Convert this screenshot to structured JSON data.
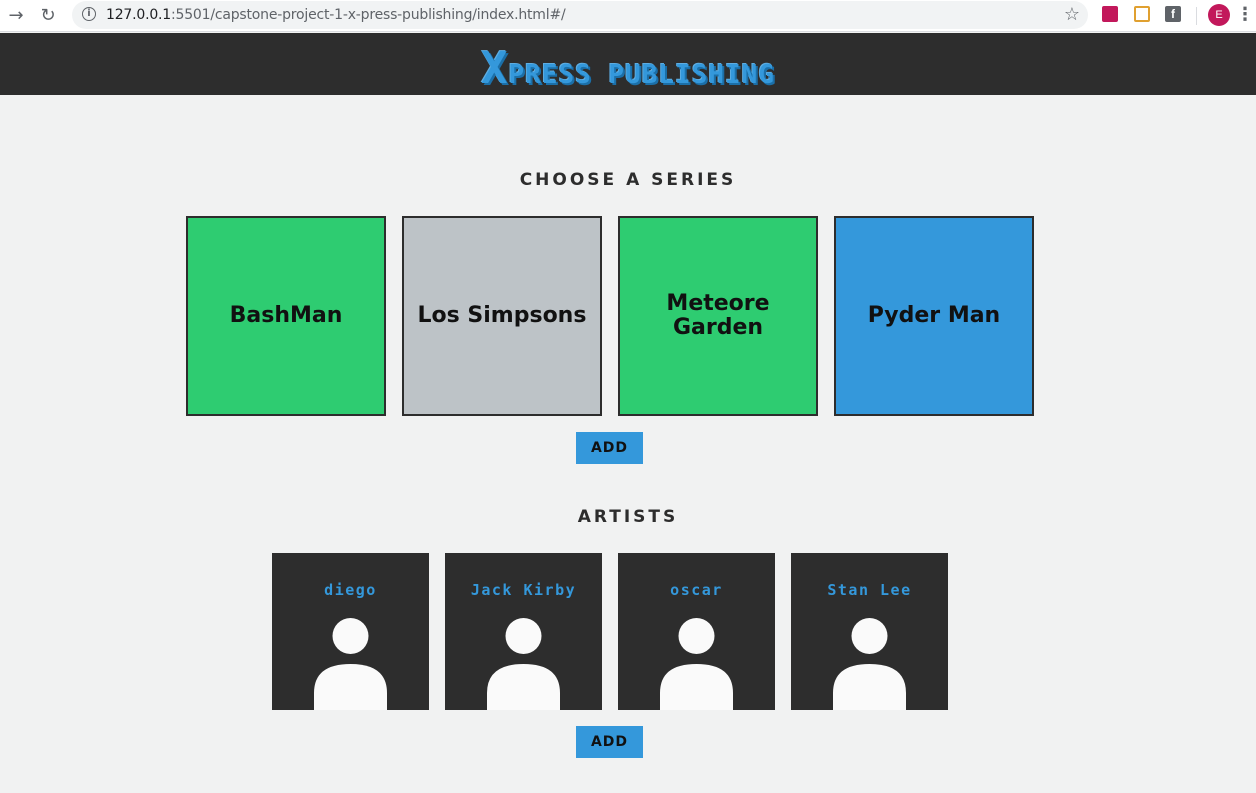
{
  "browser": {
    "url_prefix": "127.0.0.1",
    "url_rest": ":5501/capstone-project-1-x-press-publishing/index.html#/",
    "avatar_letter": "E",
    "ext3_letter": "f"
  },
  "header": {
    "logo_initial": "X",
    "logo_rest": "PRESS PUBLISHING"
  },
  "series_section": {
    "title": "CHOOSE A SERIES",
    "items": [
      {
        "name": "BashMan",
        "color": "#2ecc71"
      },
      {
        "name": "Los Simpsons",
        "color": "#bdc3c7"
      },
      {
        "name": "Meteore Garden",
        "color": "#2ecc71"
      },
      {
        "name": "Pyder Man",
        "color": "#3498db"
      }
    ],
    "add_label": "ADD"
  },
  "artists_section": {
    "title": "ARTISTS",
    "items": [
      {
        "name": "diego"
      },
      {
        "name": "Jack Kirby"
      },
      {
        "name": "oscar"
      },
      {
        "name": "Stan Lee"
      }
    ],
    "add_label": "ADD"
  },
  "colors": {
    "accent": "#3498db",
    "dark": "#2d2d2d",
    "background": "#f1f2f2"
  }
}
